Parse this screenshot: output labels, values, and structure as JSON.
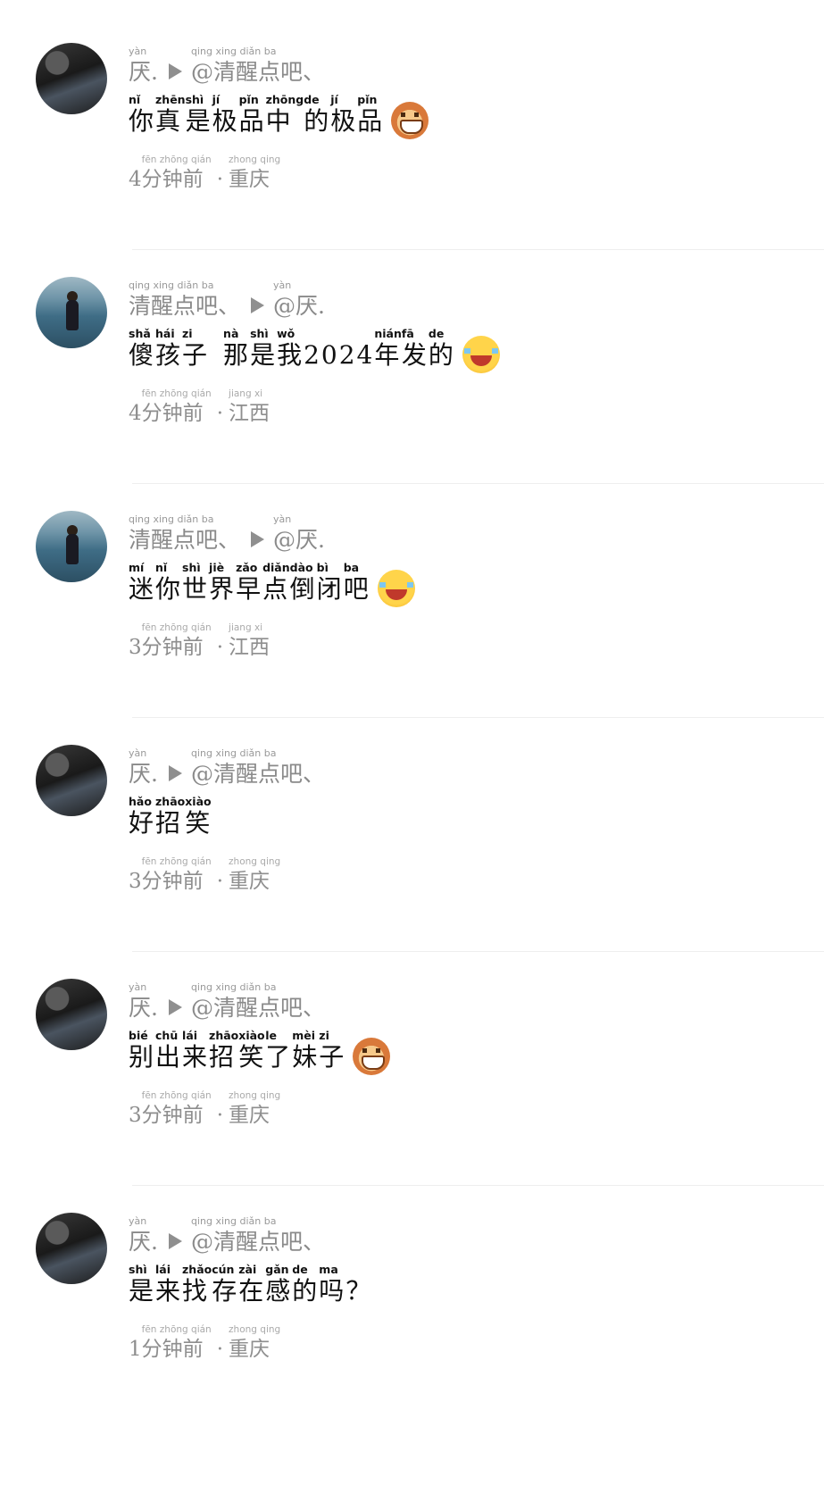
{
  "comments": [
    {
      "avatar": "dark-portrait-avatar",
      "header": {
        "user": "厌.",
        "user_py": "yàn",
        "reply_to": "@清醒点吧、",
        "reply_to_py": "qing xing diǎn ba"
      },
      "text": [
        {
          "hz": "你",
          "py": "nǐ"
        },
        {
          "hz": "真",
          "py": "zhēn"
        },
        {
          "hz": "是",
          "py": "shì"
        },
        {
          "hz": "极",
          "py": "jí"
        },
        {
          "hz": "品",
          "py": "pǐn"
        },
        {
          "hz": "中",
          "py": "zhōng"
        },
        {
          "hz": "的",
          "py": "de"
        },
        {
          "hz": "极",
          "py": "jí"
        },
        {
          "hz": "品",
          "py": "pǐn"
        }
      ],
      "emoji": "monkey-grin-emoji",
      "time": {
        "num": "4",
        "word": "分钟前",
        "word_py": "fēn zhōng qián"
      },
      "location": {
        "text": "重庆",
        "py": "zhong qing"
      }
    },
    {
      "avatar": "sea-girl-avatar",
      "header": {
        "user": "清醒点吧、",
        "user_py": "qing xing diǎn ba",
        "reply_to": "@厌.",
        "reply_to_py": "yàn"
      },
      "text": [
        {
          "hz": "傻",
          "py": "shǎ"
        },
        {
          "hz": "孩",
          "py": "hái"
        },
        {
          "hz": "子",
          "py": "zi"
        },
        {
          "hz": " ",
          "py": ""
        },
        {
          "hz": "那",
          "py": "nà"
        },
        {
          "hz": "是",
          "py": "shì"
        },
        {
          "hz": "我",
          "py": "wǒ"
        },
        {
          "hz": "2024",
          "py": ""
        },
        {
          "hz": "年",
          "py": "nián"
        },
        {
          "hz": "发",
          "py": "fā"
        },
        {
          "hz": "的",
          "py": "de"
        }
      ],
      "emoji": "tears-of-joy-emoji",
      "time": {
        "num": "4",
        "word": "分钟前",
        "word_py": "fēn zhōng qián"
      },
      "location": {
        "text": "江西",
        "py": "jiang xi"
      }
    },
    {
      "avatar": "sea-girl-avatar",
      "header": {
        "user": "清醒点吧、",
        "user_py": "qing xing diǎn ba",
        "reply_to": "@厌.",
        "reply_to_py": "yàn"
      },
      "text": [
        {
          "hz": "迷",
          "py": "mí"
        },
        {
          "hz": "你",
          "py": "nǐ"
        },
        {
          "hz": "世",
          "py": "shì"
        },
        {
          "hz": "界",
          "py": "jiè"
        },
        {
          "hz": "早",
          "py": "zǎo"
        },
        {
          "hz": "点",
          "py": "diǎn"
        },
        {
          "hz": "倒",
          "py": "dào"
        },
        {
          "hz": "闭",
          "py": "bì"
        },
        {
          "hz": "吧",
          "py": "ba"
        }
      ],
      "emoji": "tears-of-joy-emoji",
      "time": {
        "num": "3",
        "word": "分钟前",
        "word_py": "fēn zhōng qián"
      },
      "location": {
        "text": "江西",
        "py": "jiang xi"
      }
    },
    {
      "avatar": "dark-portrait-avatar",
      "header": {
        "user": "厌.",
        "user_py": "yàn",
        "reply_to": "@清醒点吧、",
        "reply_to_py": "qing xing diǎn ba"
      },
      "text": [
        {
          "hz": "好",
          "py": "hǎo"
        },
        {
          "hz": "招",
          "py": "zhāo"
        },
        {
          "hz": "笑",
          "py": "xiào"
        }
      ],
      "emoji": "",
      "time": {
        "num": "3",
        "word": "分钟前",
        "word_py": "fēn zhōng qián"
      },
      "location": {
        "text": "重庆",
        "py": "zhong qing"
      }
    },
    {
      "avatar": "dark-portrait-avatar",
      "header": {
        "user": "厌.",
        "user_py": "yàn",
        "reply_to": "@清醒点吧、",
        "reply_to_py": "qing xing diǎn ba"
      },
      "text": [
        {
          "hz": "别",
          "py": "bié"
        },
        {
          "hz": "出",
          "py": "chū"
        },
        {
          "hz": "来",
          "py": "lái"
        },
        {
          "hz": "招",
          "py": "zhāo"
        },
        {
          "hz": "笑",
          "py": "xiào"
        },
        {
          "hz": "了",
          "py": "le"
        },
        {
          "hz": "妹",
          "py": "mèi"
        },
        {
          "hz": "子",
          "py": "zi"
        }
      ],
      "emoji": "monkey-grin-emoji",
      "time": {
        "num": "3",
        "word": "分钟前",
        "word_py": "fēn zhōng qián"
      },
      "location": {
        "text": "重庆",
        "py": "zhong qing"
      }
    },
    {
      "avatar": "dark-portrait-avatar",
      "header": {
        "user": "厌.",
        "user_py": "yàn",
        "reply_to": "@清醒点吧、",
        "reply_to_py": "qing xing diǎn ba"
      },
      "text": [
        {
          "hz": "是",
          "py": "shì"
        },
        {
          "hz": "来",
          "py": "lái"
        },
        {
          "hz": "找",
          "py": "zhǎo"
        },
        {
          "hz": "存",
          "py": "cún"
        },
        {
          "hz": "在",
          "py": "zài"
        },
        {
          "hz": "感",
          "py": "gǎn"
        },
        {
          "hz": "的",
          "py": "de"
        },
        {
          "hz": "吗",
          "py": "ma"
        },
        {
          "hz": "？",
          "py": ""
        }
      ],
      "emoji": "",
      "time": {
        "num": "1",
        "word": "分钟前",
        "word_py": "fēn zhōng qián"
      },
      "location": {
        "text": "重庆",
        "py": "zhong qing"
      }
    }
  ]
}
